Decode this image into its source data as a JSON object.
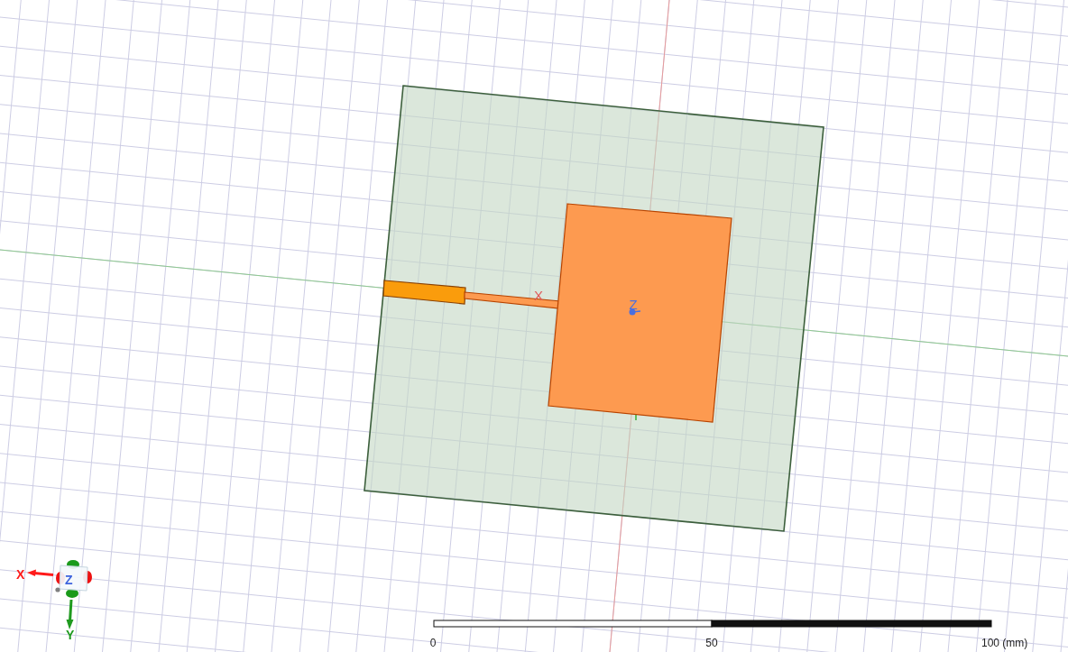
{
  "viewport": {
    "model_labels": [
      {
        "kind": "x",
        "text": "X",
        "color": "#e05a5a"
      },
      {
        "kind": "z",
        "text": "Z",
        "color": "#4a6fe0"
      }
    ],
    "triad_labels": [
      {
        "kind": "x",
        "text": "X",
        "color": "#ff1a1a"
      },
      {
        "kind": "y",
        "text": "Y",
        "color": "#1f9a1f"
      },
      {
        "kind": "z",
        "text": "Z",
        "color": "#3d63dd"
      }
    ],
    "scale_bar": {
      "tick_labels": [
        "0",
        "50",
        "100 (mm)"
      ]
    }
  }
}
